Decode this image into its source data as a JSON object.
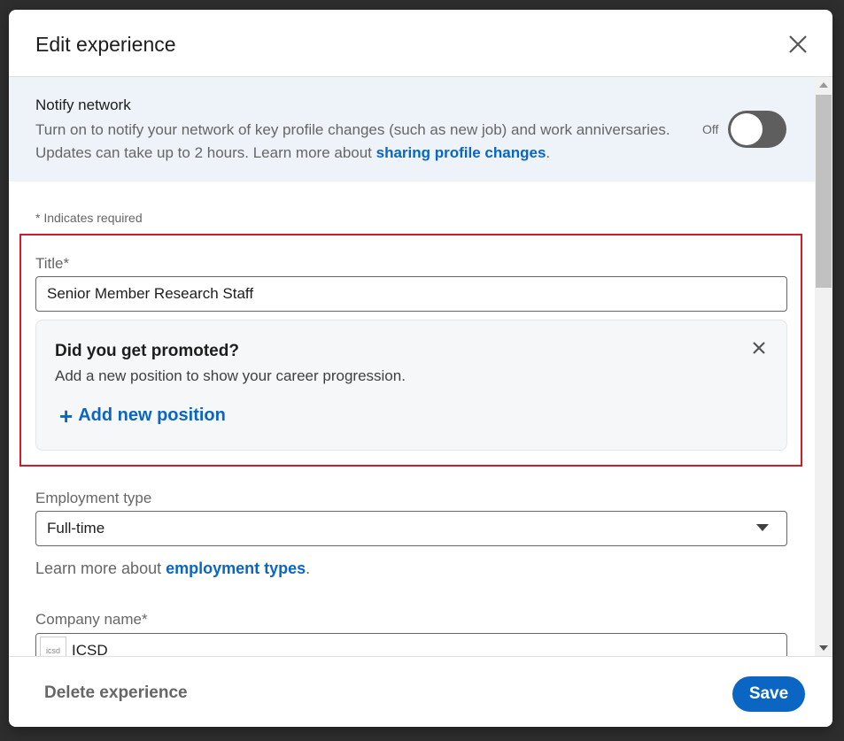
{
  "modal": {
    "title": "Edit experience"
  },
  "notify": {
    "title": "Notify network",
    "description": "Turn on to notify your network of key profile changes (such as new job) and work anniversaries. Updates can take up to 2 hours. Learn more about ",
    "link_text": "sharing profile changes",
    "link_suffix": ".",
    "toggle_label": "Off",
    "toggle_on": false
  },
  "form": {
    "required_note": "* Indicates required",
    "title_label": "Title*",
    "title_value": "Senior Member Research Staff",
    "promo": {
      "heading": "Did you get promoted?",
      "description": "Add a new position to show your career progression.",
      "add_label": "Add new position"
    },
    "employment_type_label": "Employment type",
    "employment_type_value": "Full-time",
    "learn_more_prefix": "Learn more about ",
    "learn_more_link": "employment types",
    "learn_more_suffix": ".",
    "company_label": "Company name*",
    "company_value": "ICSD",
    "company_logo_text": "icsd"
  },
  "footer": {
    "delete_label": "Delete experience",
    "save_label": "Save"
  },
  "colors": {
    "accent": "#0a66c2",
    "highlight_border": "#d11a2a",
    "notify_bg": "#edf3f8"
  }
}
